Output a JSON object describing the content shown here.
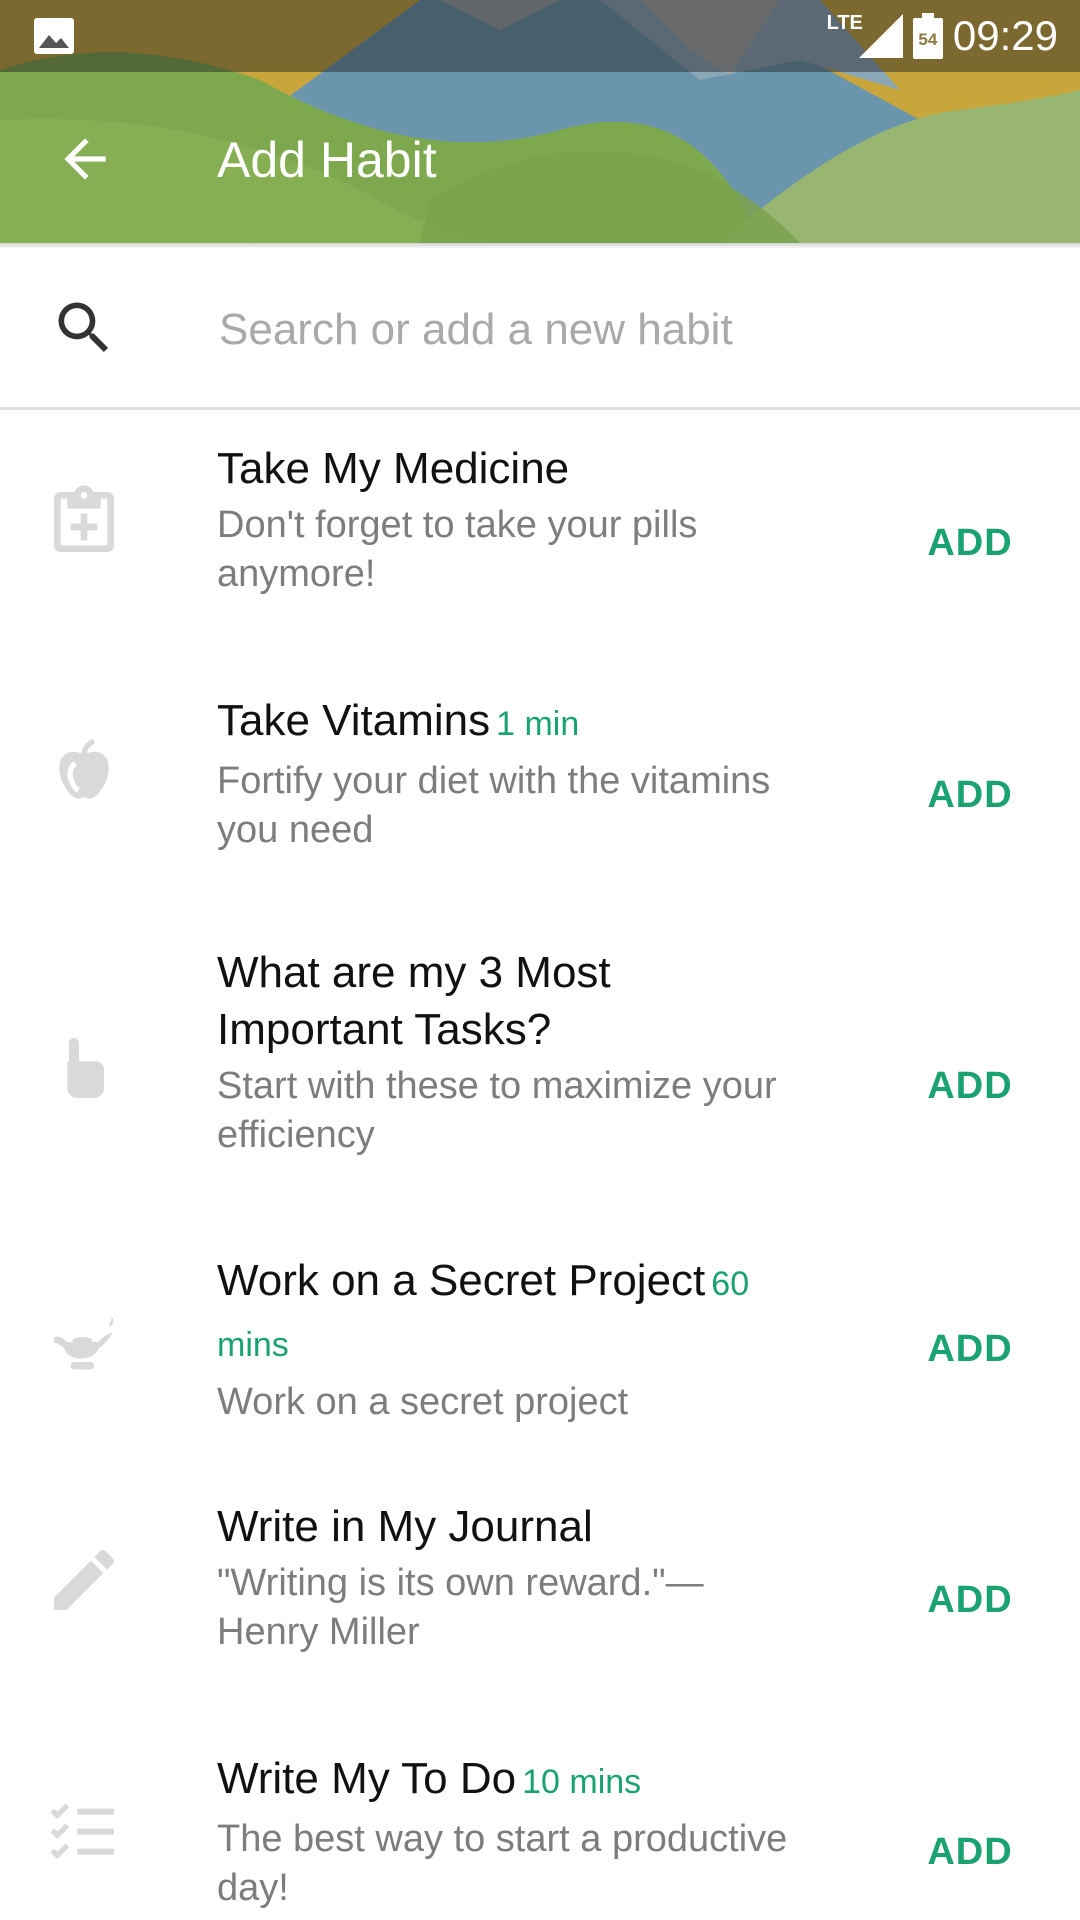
{
  "status_bar": {
    "time": "09:29",
    "network": "LTE",
    "battery": "54"
  },
  "toolbar": {
    "title": "Add Habit"
  },
  "search": {
    "placeholder": "Search or add a new habit"
  },
  "colors": {
    "accent": "#1aa36f",
    "header_green": "#7fa94f",
    "header_blue": "#6f9ab3"
  },
  "habits": [
    {
      "title": "Take My Medicine",
      "duration": "",
      "description": "Don't forget to take your pills anymore!",
      "action": "ADD",
      "icon": "clipboard-plus-icon"
    },
    {
      "title": "Take Vitamins",
      "duration": "1 min",
      "description": "Fortify your diet with the vitamins you need",
      "action": "ADD",
      "icon": "apple-icon"
    },
    {
      "title": "What are my 3 Most Important Tasks?",
      "duration": "",
      "description": "Start with these to maximize your efficiency",
      "action": "ADD",
      "icon": "pointing-hand-icon"
    },
    {
      "title": "Work on a Secret Project",
      "duration": "60 mins",
      "description": "Work on a secret project",
      "action": "ADD",
      "icon": "magic-lamp-icon"
    },
    {
      "title": "Write in My Journal",
      "duration": "",
      "description": "\"Writing is its own reward.\"— Henry Miller",
      "action": "ADD",
      "icon": "pencil-icon"
    },
    {
      "title": "Write My To Do",
      "duration": "10 mins",
      "description": "The best way to start a productive day!",
      "action": "ADD",
      "icon": "checklist-icon"
    }
  ]
}
